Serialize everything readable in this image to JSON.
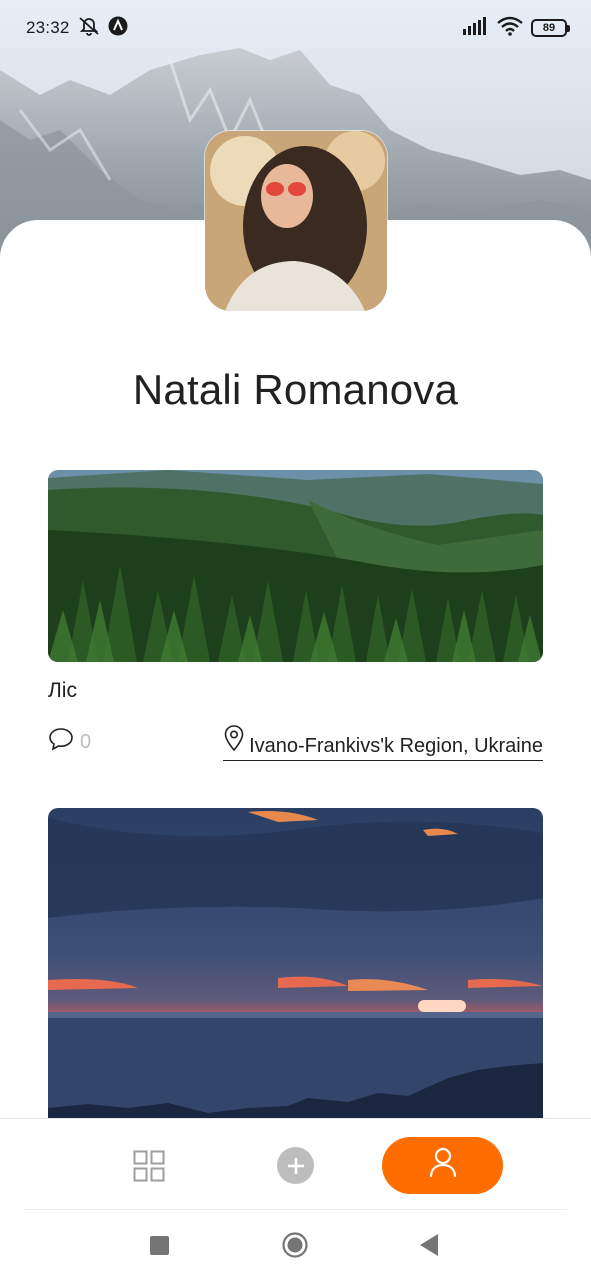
{
  "status_bar": {
    "time": "23:32",
    "battery_level": "89",
    "icons": [
      "mute-icon",
      "app-notification-icon",
      "signal-icon",
      "wifi-icon",
      "battery-icon"
    ]
  },
  "profile": {
    "name": "Natali Romanova"
  },
  "posts": [
    {
      "title": "Ліс",
      "comments_count": "0",
      "location": "Ivano-Frankivs'k Region, Ukraine"
    }
  ],
  "bottom_nav": {
    "items": [
      "grid-icon",
      "add-icon",
      "user-icon"
    ],
    "active": "user-icon"
  },
  "system_nav": {
    "items": [
      "recents-icon",
      "home-icon",
      "back-icon"
    ]
  },
  "colors": {
    "accent": "#FF6C00",
    "muted": "#BDBDBD",
    "text": "#212121"
  }
}
